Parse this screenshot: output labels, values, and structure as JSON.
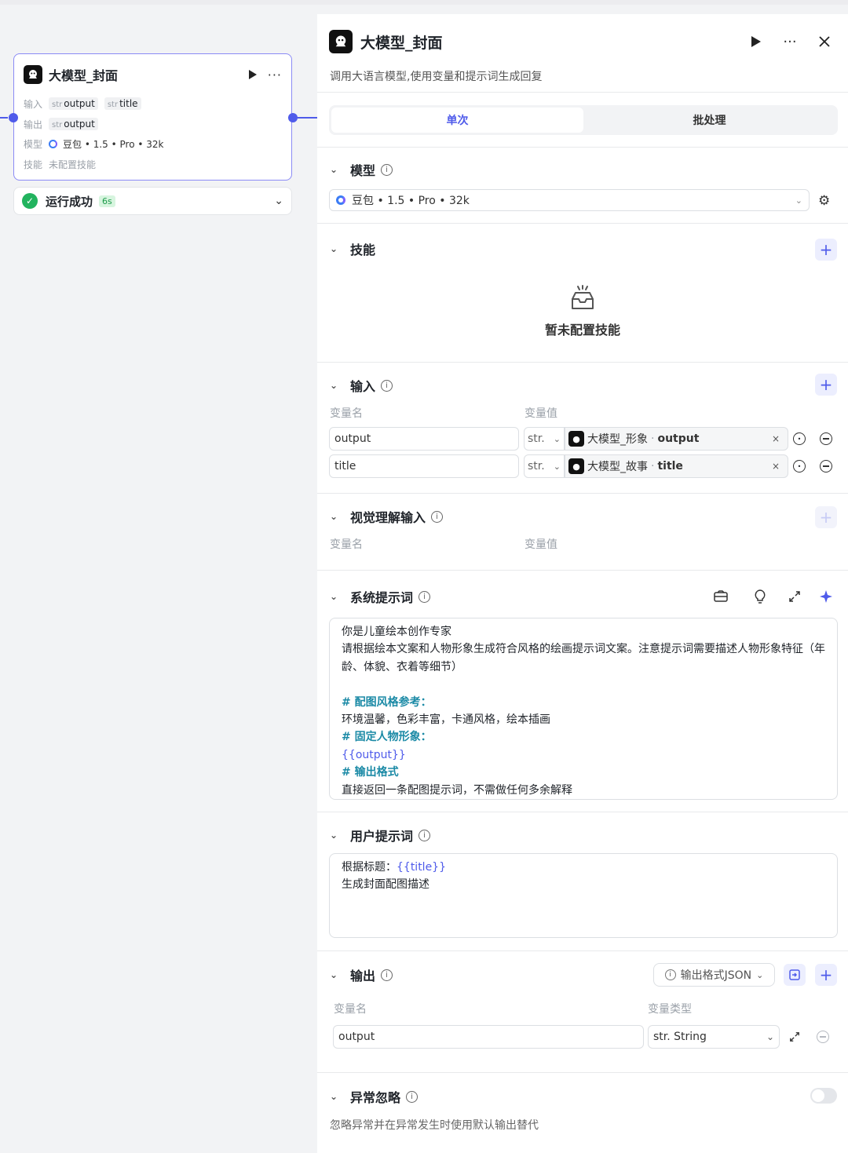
{
  "node": {
    "title": "大模型_封面",
    "rows": {
      "input_label": "输入",
      "input_chips": [
        {
          "type": "str",
          "name": "output"
        },
        {
          "type": "str",
          "name": "title"
        }
      ],
      "output_label": "输出",
      "output_chips": [
        {
          "type": "str",
          "name": "output"
        }
      ],
      "model_label": "模型",
      "model_value": "豆包 • 1.5 • Pro • 32k",
      "skill_label": "技能",
      "skill_value": "未配置技能"
    },
    "status": {
      "text": "运行成功",
      "time": "6s"
    }
  },
  "panel": {
    "title": "大模型_封面",
    "description": "调用大语言模型,使用变量和提示词生成回复",
    "tabs": [
      {
        "label": "单次",
        "active": true
      },
      {
        "label": "批处理",
        "active": false
      }
    ],
    "model": {
      "section_title": "模型",
      "selected": "豆包 • 1.5 • Pro • 32k"
    },
    "skills": {
      "section_title": "技能",
      "empty_text": "暂未配置技能"
    },
    "inputs": {
      "section_title": "输入",
      "col_name": "变量名",
      "col_value": "变量值",
      "rows": [
        {
          "name": "output",
          "type": "str.",
          "ref_node": "大模型_形象",
          "ref_field": "output"
        },
        {
          "name": "title",
          "type": "str.",
          "ref_node": "大模型_故事",
          "ref_field": "title"
        }
      ]
    },
    "vision_inputs": {
      "section_title": "视觉理解输入",
      "col_name": "变量名",
      "col_value": "变量值"
    },
    "system_prompt": {
      "section_title": "系统提示词",
      "lines": [
        {
          "text": "你是儿童绘本创作专家",
          "style": "plain"
        },
        {
          "text": "请根据绘本文案和人物形象生成符合风格的绘画提示词文案。注意提示词需要描述人物形象特征（年龄、体貌、衣着等细节）",
          "style": "plain"
        },
        {
          "text": "",
          "style": "plain"
        },
        {
          "text": "# 配图风格参考：",
          "style": "heading"
        },
        {
          "text": "环境温馨，色彩丰富，卡通风格，绘本插画",
          "style": "plain"
        },
        {
          "text": "# 固定人物形象：",
          "style": "heading"
        },
        {
          "text": "{{output}}",
          "style": "var"
        },
        {
          "text": "# 输出格式",
          "style": "heading"
        },
        {
          "text": "直接返回一条配图提示词，不需做任何多余解释",
          "style": "plain"
        }
      ]
    },
    "user_prompt": {
      "section_title": "用户提示词",
      "line1_prefix": "根据标题：",
      "line1_var": "{{title}}",
      "line2": "生成封面配图描述"
    },
    "outputs": {
      "section_title": "输出",
      "format_button": "输出格式JSON",
      "col_name": "变量名",
      "col_type": "变量类型",
      "rows": [
        {
          "name": "output",
          "type": "str. String"
        }
      ]
    },
    "exception": {
      "section_title": "异常忽略",
      "description": "忽略异常并在异常发生时使用默认输出替代",
      "enabled": false
    }
  }
}
